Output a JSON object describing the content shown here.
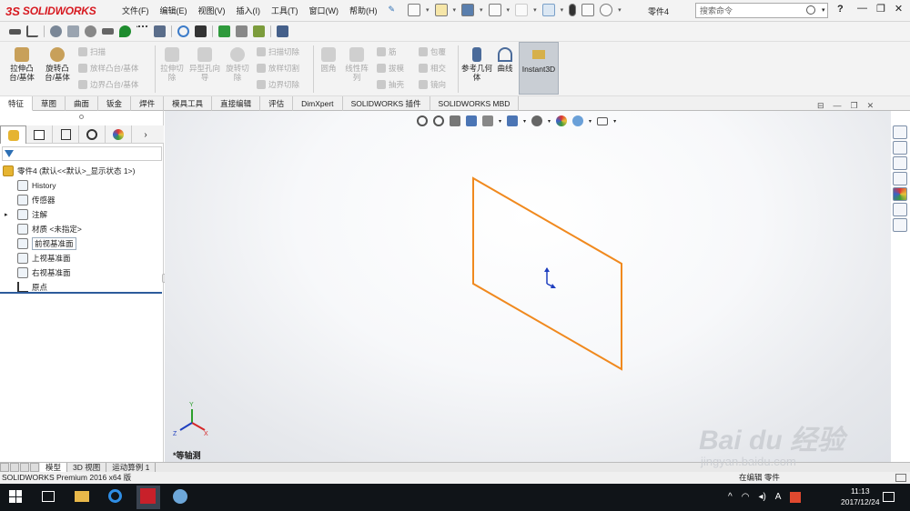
{
  "app": {
    "brand_prefix": "3S",
    "brand_name": "SOLIDWORKS",
    "document_title": "零件4"
  },
  "menu": [
    "文件(F)",
    "编辑(E)",
    "视图(V)",
    "插入(I)",
    "工具(T)",
    "窗口(W)",
    "帮助(H)"
  ],
  "search": {
    "placeholder": "搜索命令"
  },
  "help_label": "?",
  "window_controls": {
    "minimize": "—",
    "restore": "❐",
    "close": "✕"
  },
  "command_manager": {
    "extrude_boss": "拉伸凸台/基体",
    "revolve_boss": "旋转凸台/基体",
    "sweep": "扫描",
    "loft": "放样凸台/基体",
    "boundary": "边界凸台/基体",
    "extrude_cut": "拉伸切除",
    "hole_wizard": "异型孔向导",
    "revolve_cut": "旋转切除",
    "swept_cut": "扫描切除",
    "lofted_cut": "放样切割",
    "boundary_cut": "边界切除",
    "fillet": "圆角",
    "linear_pattern": "线性阵列",
    "rib": "筋",
    "draft": "拔模",
    "shell": "抽壳",
    "wrap": "包覆",
    "intersect": "相交",
    "mirror": "镜向",
    "reference_geometry": "参考几何体",
    "curves": "曲线",
    "instant3d": "Instant3D"
  },
  "tabs": [
    {
      "label": "特征",
      "active": true
    },
    {
      "label": "草图",
      "active": false
    },
    {
      "label": "曲面",
      "active": false
    },
    {
      "label": "钣金",
      "active": false
    },
    {
      "label": "焊件",
      "active": false
    },
    {
      "label": "模具工具",
      "active": false
    },
    {
      "label": "直接编辑",
      "active": false
    },
    {
      "label": "评估",
      "active": false
    },
    {
      "label": "DimXpert",
      "active": false
    },
    {
      "label": "SOLIDWORKS 插件",
      "active": false
    },
    {
      "label": "SOLIDWORKS MBD",
      "active": false
    }
  ],
  "tree": {
    "root": "零件4 (默认<<默认>_显示状态 1>)",
    "items": [
      {
        "label": "History",
        "icon": "history-icon",
        "expander": false
      },
      {
        "label": "传感器",
        "icon": "sensor-icon",
        "expander": false
      },
      {
        "label": "注解",
        "icon": "annotation-icon",
        "expander": true
      },
      {
        "label": "材质 <未指定>",
        "icon": "material-icon",
        "expander": false
      },
      {
        "label": "前视基准面",
        "icon": "plane-icon",
        "expander": false,
        "selected": true
      },
      {
        "label": "上视基准面",
        "icon": "plane-icon",
        "expander": false
      },
      {
        "label": "右视基准面",
        "icon": "plane-icon",
        "expander": false
      },
      {
        "label": "原点",
        "icon": "origin-icon",
        "expander": false
      }
    ]
  },
  "viewport": {
    "view_name": "*等轴测",
    "triad_labels": {
      "x": "X",
      "y": "Y",
      "z": "Z"
    },
    "plane_color": "#f0891e",
    "origin_color": "#1f3fbf"
  },
  "bottom_tabs": [
    {
      "label": "模型",
      "active": true
    },
    {
      "label": "3D 视图",
      "active": false
    },
    {
      "label": "运动算例 1",
      "active": false
    }
  ],
  "status": {
    "left": "SOLIDWORKS Premium 2016 x64 版",
    "right": "在编辑 零件"
  },
  "taskbar": {
    "time": "11:13",
    "date": "2017/12/24",
    "ime": "A"
  },
  "watermark": {
    "main": "Bai du 经验",
    "sub": "jingyan.baidu.com"
  }
}
